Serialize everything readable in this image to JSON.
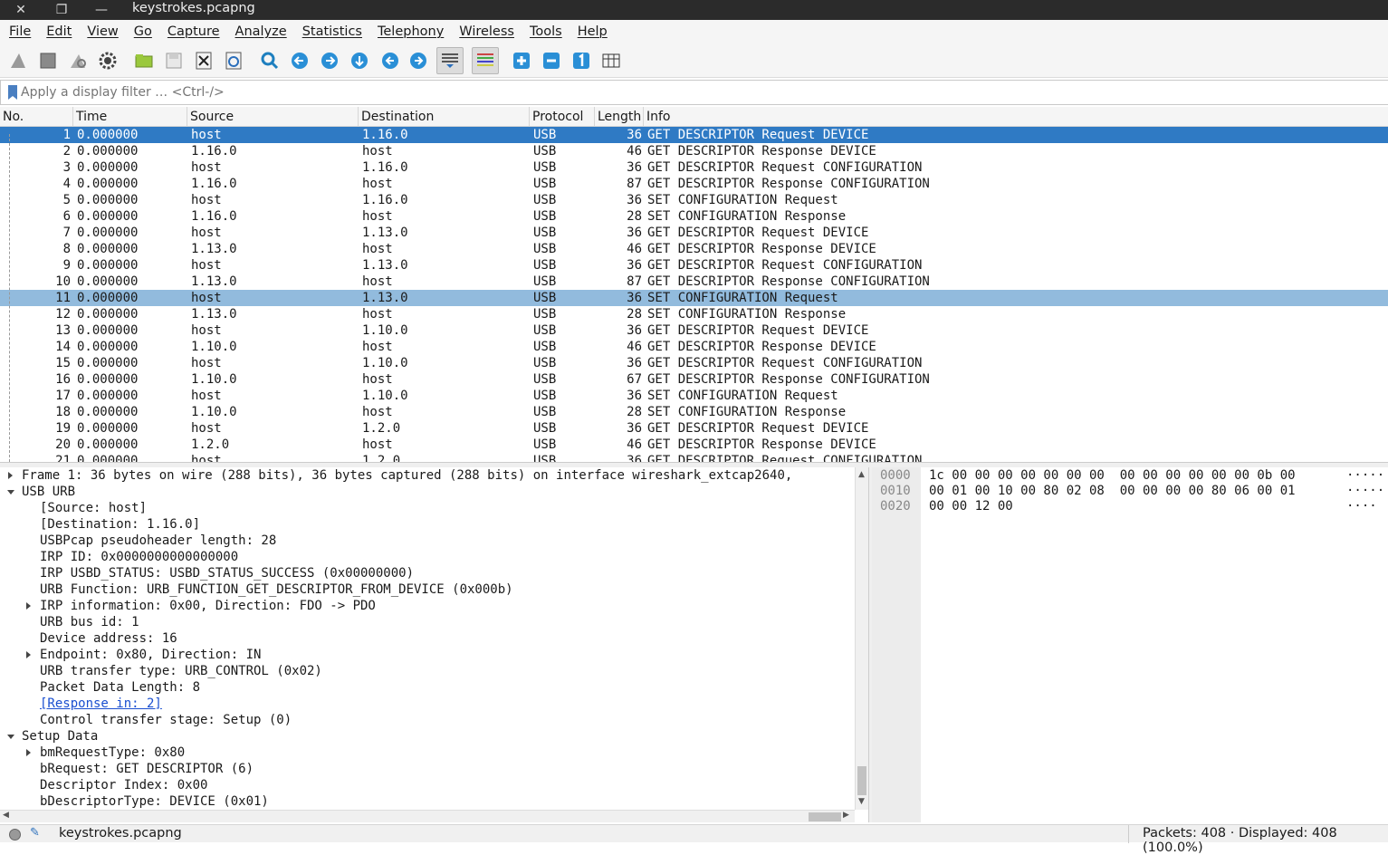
{
  "window": {
    "title": "keystrokes.pcapng"
  },
  "menu": [
    "File",
    "Edit",
    "View",
    "Go",
    "Capture",
    "Analyze",
    "Statistics",
    "Telephony",
    "Wireless",
    "Tools",
    "Help"
  ],
  "toolbar": {
    "icons": [
      "shark-fin-start-icon",
      "stop-square-icon",
      "restart-capture-icon",
      "capture-options-gear-icon",
      "open-folder-icon",
      "save-file-icon",
      "close-file-icon",
      "reload-file-icon",
      "find-packet-icon",
      "go-back-icon",
      "go-forward-icon",
      "go-to-packet-icon",
      "first-packet-icon",
      "last-packet-icon",
      "autoscroll-icon",
      "colorize-icon",
      "zoom-in-icon",
      "zoom-out-icon",
      "normal-size-icon",
      "resize-columns-icon"
    ]
  },
  "filter": {
    "placeholder": "Apply a display filter … <Ctrl-/>"
  },
  "columns": {
    "no": "No.",
    "time": "Time",
    "source": "Source",
    "destination": "Destination",
    "protocol": "Protocol",
    "length": "Length",
    "info": "Info"
  },
  "packets": [
    {
      "no": "1",
      "time": "0.000000",
      "src": "host",
      "dst": "1.16.0",
      "proto": "USB",
      "len": "36",
      "info": "GET DESCRIPTOR Request DEVICE"
    },
    {
      "no": "2",
      "time": "0.000000",
      "src": "1.16.0",
      "dst": "host",
      "proto": "USB",
      "len": "46",
      "info": "GET DESCRIPTOR Response DEVICE"
    },
    {
      "no": "3",
      "time": "0.000000",
      "src": "host",
      "dst": "1.16.0",
      "proto": "USB",
      "len": "36",
      "info": "GET DESCRIPTOR Request CONFIGURATION"
    },
    {
      "no": "4",
      "time": "0.000000",
      "src": "1.16.0",
      "dst": "host",
      "proto": "USB",
      "len": "87",
      "info": "GET DESCRIPTOR Response CONFIGURATION"
    },
    {
      "no": "5",
      "time": "0.000000",
      "src": "host",
      "dst": "1.16.0",
      "proto": "USB",
      "len": "36",
      "info": "SET CONFIGURATION Request"
    },
    {
      "no": "6",
      "time": "0.000000",
      "src": "1.16.0",
      "dst": "host",
      "proto": "USB",
      "len": "28",
      "info": "SET CONFIGURATION Response"
    },
    {
      "no": "7",
      "time": "0.000000",
      "src": "host",
      "dst": "1.13.0",
      "proto": "USB",
      "len": "36",
      "info": "GET DESCRIPTOR Request DEVICE"
    },
    {
      "no": "8",
      "time": "0.000000",
      "src": "1.13.0",
      "dst": "host",
      "proto": "USB",
      "len": "46",
      "info": "GET DESCRIPTOR Response DEVICE"
    },
    {
      "no": "9",
      "time": "0.000000",
      "src": "host",
      "dst": "1.13.0",
      "proto": "USB",
      "len": "36",
      "info": "GET DESCRIPTOR Request CONFIGURATION"
    },
    {
      "no": "10",
      "time": "0.000000",
      "src": "1.13.0",
      "dst": "host",
      "proto": "USB",
      "len": "87",
      "info": "GET DESCRIPTOR Response CONFIGURATION"
    },
    {
      "no": "11",
      "time": "0.000000",
      "src": "host",
      "dst": "1.13.0",
      "proto": "USB",
      "len": "36",
      "info": "SET CONFIGURATION Request"
    },
    {
      "no": "12",
      "time": "0.000000",
      "src": "1.13.0",
      "dst": "host",
      "proto": "USB",
      "len": "28",
      "info": "SET CONFIGURATION Response"
    },
    {
      "no": "13",
      "time": "0.000000",
      "src": "host",
      "dst": "1.10.0",
      "proto": "USB",
      "len": "36",
      "info": "GET DESCRIPTOR Request DEVICE"
    },
    {
      "no": "14",
      "time": "0.000000",
      "src": "1.10.0",
      "dst": "host",
      "proto": "USB",
      "len": "46",
      "info": "GET DESCRIPTOR Response DEVICE"
    },
    {
      "no": "15",
      "time": "0.000000",
      "src": "host",
      "dst": "1.10.0",
      "proto": "USB",
      "len": "36",
      "info": "GET DESCRIPTOR Request CONFIGURATION"
    },
    {
      "no": "16",
      "time": "0.000000",
      "src": "1.10.0",
      "dst": "host",
      "proto": "USB",
      "len": "67",
      "info": "GET DESCRIPTOR Response CONFIGURATION"
    },
    {
      "no": "17",
      "time": "0.000000",
      "src": "host",
      "dst": "1.10.0",
      "proto": "USB",
      "len": "36",
      "info": "SET CONFIGURATION Request"
    },
    {
      "no": "18",
      "time": "0.000000",
      "src": "1.10.0",
      "dst": "host",
      "proto": "USB",
      "len": "28",
      "info": "SET CONFIGURATION Response"
    },
    {
      "no": "19",
      "time": "0.000000",
      "src": "host",
      "dst": "1.2.0",
      "proto": "USB",
      "len": "36",
      "info": "GET DESCRIPTOR Request DEVICE"
    },
    {
      "no": "20",
      "time": "0.000000",
      "src": "1.2.0",
      "dst": "host",
      "proto": "USB",
      "len": "46",
      "info": "GET DESCRIPTOR Response DEVICE"
    },
    {
      "no": "21",
      "time": "0.000000",
      "src": "host",
      "dst": "1.2.0",
      "proto": "USB",
      "len": "36",
      "info": "GET DESCRIPTOR Request CONFIGURATION"
    }
  ],
  "selection": {
    "selected_packet": "1",
    "related_packet": "11",
    "selected_color": "#2f7ac4",
    "related_color": "#92bbdd"
  },
  "details": [
    {
      "text": "Frame 1: 36 bytes on wire (288 bits), 36 bytes captured (288 bits) on interface wireshark_extcap2640,",
      "level": 0,
      "expander": "right"
    },
    {
      "text": "USB URB",
      "level": 0,
      "expander": "down"
    },
    {
      "text": "[Source: host]",
      "level": 1,
      "expander": ""
    },
    {
      "text": "[Destination: 1.16.0]",
      "level": 1,
      "expander": ""
    },
    {
      "text": "USBPcap pseudoheader length: 28",
      "level": 1,
      "expander": ""
    },
    {
      "text": "IRP ID: 0x0000000000000000",
      "level": 1,
      "expander": ""
    },
    {
      "text": "IRP USBD_STATUS: USBD_STATUS_SUCCESS (0x00000000)",
      "level": 1,
      "expander": ""
    },
    {
      "text": "URB Function: URB_FUNCTION_GET_DESCRIPTOR_FROM_DEVICE (0x000b)",
      "level": 1,
      "expander": ""
    },
    {
      "text": "IRP information: 0x00, Direction: FDO -> PDO",
      "level": 1,
      "expander": "right"
    },
    {
      "text": "URB bus id: 1",
      "level": 1,
      "expander": ""
    },
    {
      "text": "Device address: 16",
      "level": 1,
      "expander": ""
    },
    {
      "text": "Endpoint: 0x80, Direction: IN",
      "level": 1,
      "expander": "right"
    },
    {
      "text": "URB transfer type: URB_CONTROL (0x02)",
      "level": 1,
      "expander": ""
    },
    {
      "text": "Packet Data Length: 8",
      "level": 1,
      "expander": ""
    },
    {
      "text": "[Response in: 2]",
      "level": 1,
      "expander": "",
      "link": true
    },
    {
      "text": "Control transfer stage: Setup (0)",
      "level": 1,
      "expander": ""
    },
    {
      "text": "Setup Data",
      "level": 0,
      "expander": "down"
    },
    {
      "text": "bmRequestType: 0x80",
      "level": 1,
      "expander": "right"
    },
    {
      "text": "bRequest: GET DESCRIPTOR (6)",
      "level": 1,
      "expander": ""
    },
    {
      "text": "Descriptor Index: 0x00",
      "level": 1,
      "expander": ""
    },
    {
      "text": "bDescriptorType: DEVICE (0x01)",
      "level": 1,
      "expander": ""
    }
  ],
  "bytes": [
    {
      "offset": "0000",
      "hex": "1c 00 00 00 00 00 00 00  00 00 00 00 00 00 0b 00",
      "ascii": "·····"
    },
    {
      "offset": "0010",
      "hex": "00 01 00 10 00 80 02 08  00 00 00 00 80 06 00 01",
      "ascii": "·····"
    },
    {
      "offset": "0020",
      "hex": "00 00 12 00",
      "ascii": "····"
    }
  ],
  "status": {
    "file": "keystrokes.pcapng",
    "counts": "Packets: 408 · Displayed: 408 (100.0%)"
  }
}
